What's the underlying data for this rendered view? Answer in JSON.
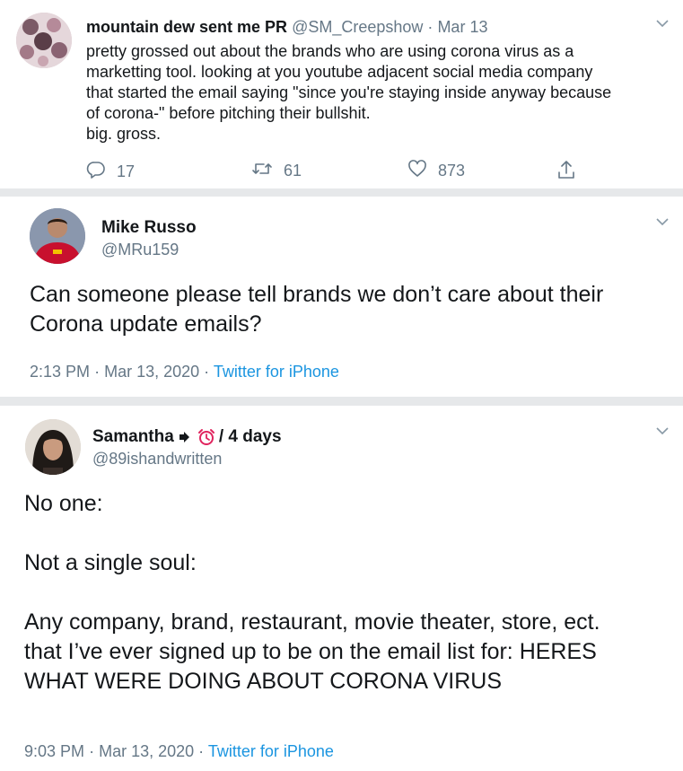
{
  "tweets": [
    {
      "display_name": "mountain dew sent me PR",
      "handle": "@SM_Creepshow",
      "separator": "·",
      "date": "Mar 13",
      "text": "pretty grossed out about the brands who are using corona virus as a\nmarketting tool. looking at you youtube adjacent social media company\nthat started the email saying \"since you're staying inside anyway because\nof corona-\" before pitching their bullshit.\nbig. gross.",
      "replies": "17",
      "retweets": "61",
      "likes": "873",
      "icons": [
        "reply-icon",
        "retweet-icon",
        "like-icon",
        "share-icon",
        "chevron-down-icon"
      ]
    },
    {
      "display_name": "Mike Russo",
      "handle": "@MRu159",
      "text": "Can someone please tell brands we don’t care about their\nCorona update emails?",
      "time": "2:13 PM",
      "separator": "·",
      "date": "Mar 13, 2020",
      "source": "Twitter for iPhone"
    },
    {
      "display_name_prefix": "Samantha",
      "display_name_suffix": "/ 4 days",
      "handle": "@89ishandwritten",
      "text": "No one:\n\nNot a single soul:\n\nAny company, brand, restaurant, movie theater, store, ect.\nthat I’ve ever signed up to be on the email list for: HERES\nWHAT WERE DOING ABOUT CORONA VIRUS",
      "time": "9:03 PM",
      "separator": "·",
      "date": "Mar 13, 2020",
      "source": "Twitter for iPhone",
      "name_icons": [
        "arrow-right-icon",
        "alarm-clock-icon"
      ]
    }
  ],
  "colors": {
    "text": "#14171a",
    "secondary": "#657786",
    "link": "#1b95e0",
    "clock": "#e0245e"
  }
}
